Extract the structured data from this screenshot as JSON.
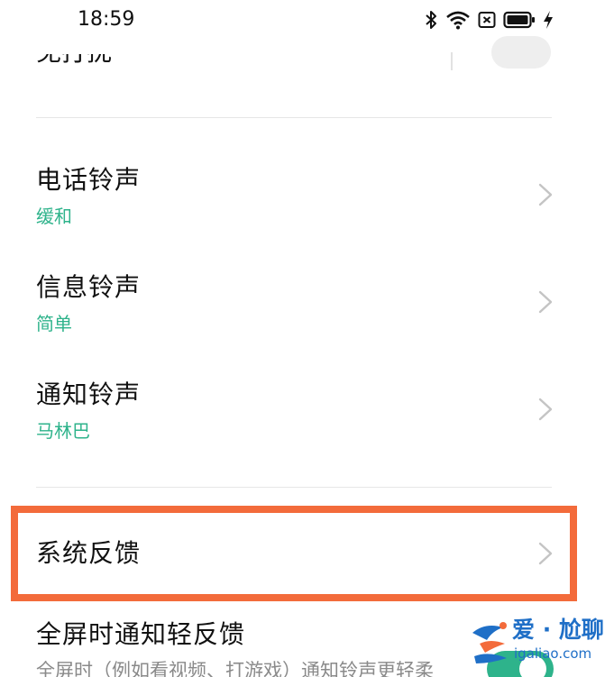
{
  "status_bar": {
    "time": "18:59",
    "icons": [
      "bluetooth-icon",
      "wifi-icon",
      "no-sim-icon",
      "battery-icon",
      "charging-icon"
    ]
  },
  "partial_row": {
    "title": "免打扰"
  },
  "rows": [
    {
      "title": "电话铃声",
      "subtitle": "缓和"
    },
    {
      "title": "信息铃声",
      "subtitle": "简单"
    },
    {
      "title": "通知铃声",
      "subtitle": "马林巴"
    }
  ],
  "feedback_row": {
    "title": "系统反馈"
  },
  "fullscreen_row": {
    "title": "全屏时通知轻反馈",
    "subtitle": "全屏时（例如看视频、打游戏）通知铃声更轻柔",
    "enabled": true
  },
  "watermark": {
    "name": "爱 · 尬聊",
    "url": "igaliao.com"
  },
  "colors": {
    "accent": "#2eb38b",
    "highlight": "#f36b3b",
    "watermark": "#1f6fc7"
  }
}
